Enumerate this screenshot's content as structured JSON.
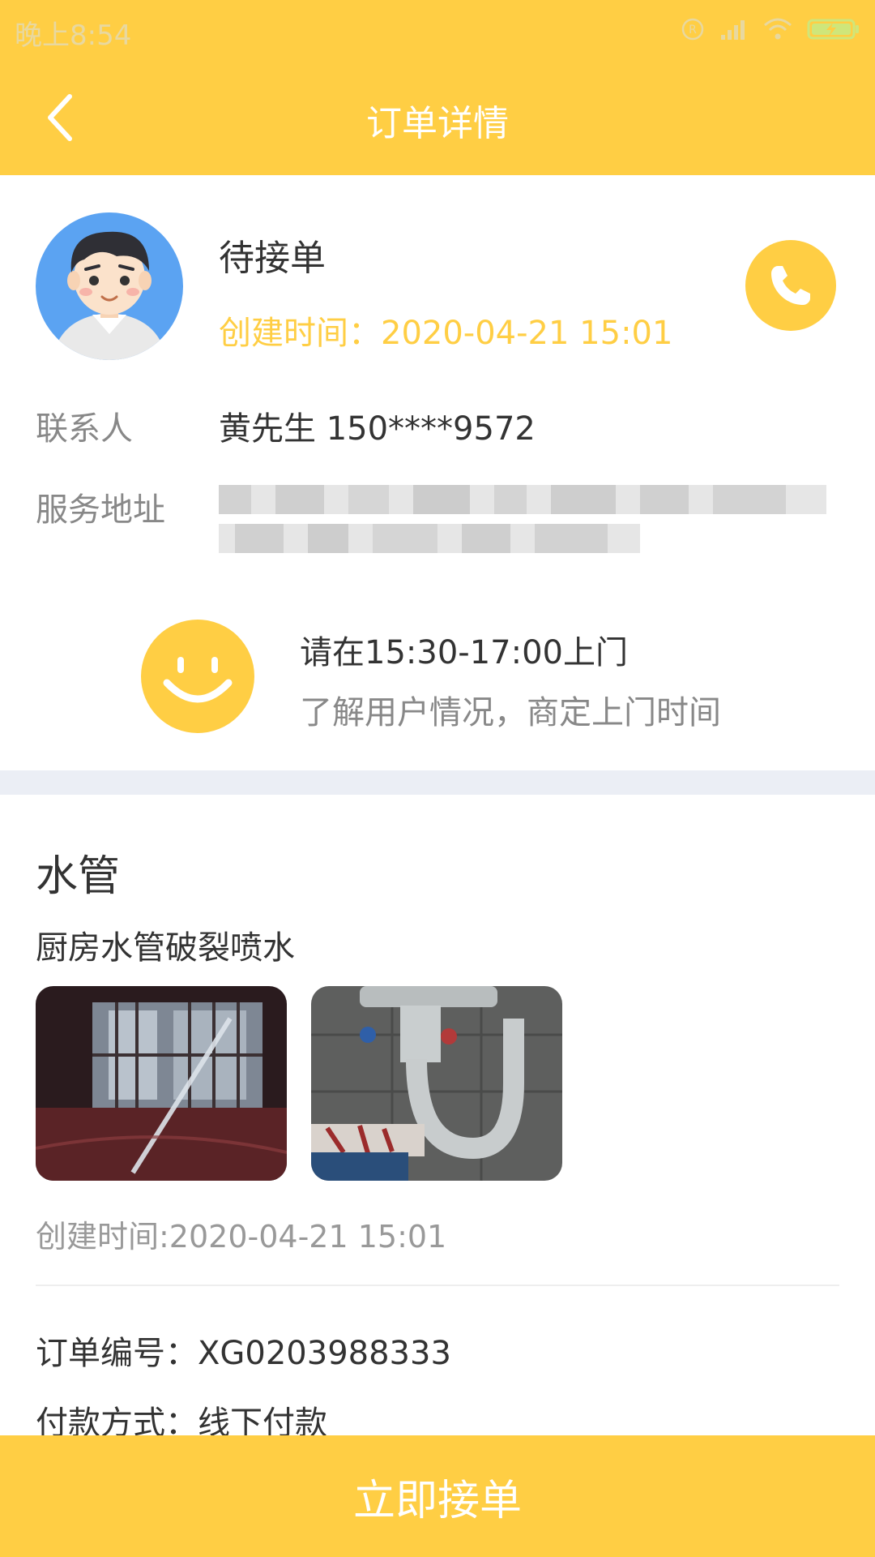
{
  "status_bar": {
    "time": "晚上8:54"
  },
  "header": {
    "title": "订单详情"
  },
  "order": {
    "status": "待接单",
    "created_time": "创建时间：2020-04-21 15:01"
  },
  "contact": {
    "label": "联系人",
    "value": "黄先生   150****9572"
  },
  "address": {
    "label": "服务地址"
  },
  "visit": {
    "title": "请在15:30-17:00上门",
    "hint": "了解用户情况，商定上门时间"
  },
  "service": {
    "type": "水管",
    "description": "厨房水管破裂喷水",
    "created_time": "创建时间:2020-04-21 15:01"
  },
  "details": {
    "order_no": "订单编号：XG0203988333",
    "payment": "付款方式：线下付款"
  },
  "footer": {
    "accept_label": "立即接单"
  },
  "colors": {
    "accent": "#FFCE44",
    "separator": "#EBEEF5",
    "avatar_bg": "#5BA3F2"
  }
}
